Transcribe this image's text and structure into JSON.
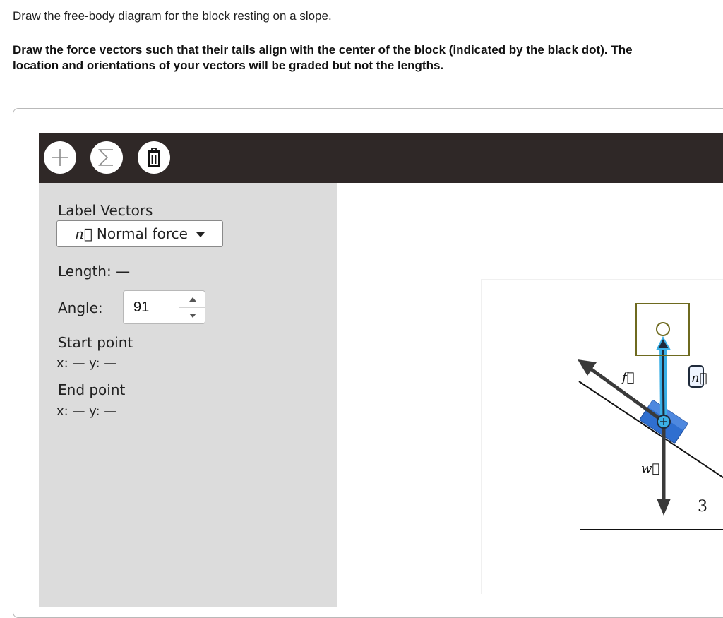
{
  "prompt": "Draw the free-body diagram for the block resting on a slope.",
  "instructions": "Draw the force vectors such that their tails align with the center of the block (indicated by the black dot). The location and orientations of your vectors will be graded but not the lengths.",
  "toolbar": {
    "buttons": [
      {
        "name": "add",
        "icon": "plus-icon"
      },
      {
        "name": "sum",
        "icon": "sigma-icon"
      },
      {
        "name": "delete",
        "icon": "trash-icon"
      }
    ]
  },
  "sidebar": {
    "label_vectors": "Label Vectors",
    "selected_vector_symbol": "n⃗",
    "selected_vector_name": "Normal force",
    "length_label": "Length: —",
    "angle_label": "Angle:",
    "angle_value": "91",
    "start_point_label": "Start point",
    "start_point_coords": "x: — y: —",
    "end_point_label": "End point",
    "end_point_coords": "x: — y: —"
  },
  "diagram": {
    "vector_labels": {
      "friction": "f⃗",
      "normal": "n⃗",
      "weight": "w⃗"
    },
    "angle_text_partial": "3",
    "colors": {
      "toolbar_bg": "#2f2827",
      "sidebar_bg": "#dcdcdc",
      "selected_vector": "#3bb0e6",
      "block": "#2f6fd0",
      "handle_box": "#6e6a1f"
    }
  }
}
